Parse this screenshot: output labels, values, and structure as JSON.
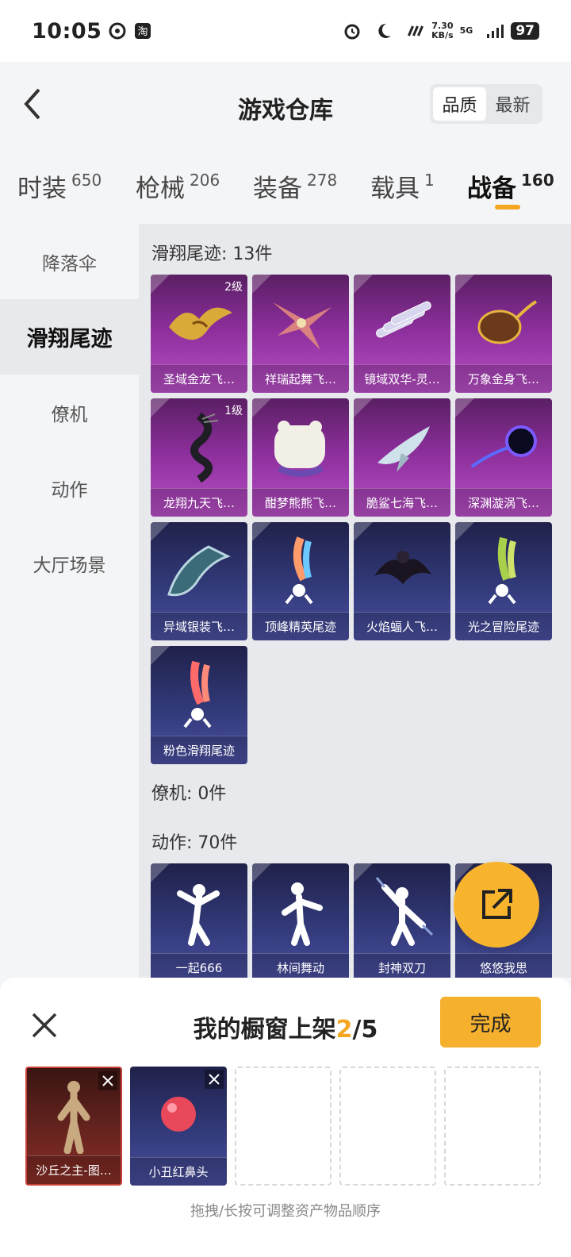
{
  "status_bar": {
    "time": "10:05",
    "net_speed_value": "7.30",
    "net_speed_unit": "KB/s",
    "network": "5G",
    "battery": "97"
  },
  "header": {
    "title": "游戏仓库",
    "sort_options": [
      "品质",
      "最新"
    ],
    "active_sort": "品质"
  },
  "category_tabs": [
    {
      "label": "时装",
      "count": "650"
    },
    {
      "label": "枪械",
      "count": "206"
    },
    {
      "label": "装备",
      "count": "278"
    },
    {
      "label": "载具",
      "count": "1"
    },
    {
      "label": "战备",
      "count": "160"
    }
  ],
  "active_tab": "战备",
  "sidebar": {
    "items": [
      "降落伞",
      "滑翔尾迹",
      "僚机",
      "动作",
      "大厅场景"
    ],
    "active": "滑翔尾迹"
  },
  "sections": {
    "glide_trails": {
      "title": "滑翔尾迹: 13件",
      "items": [
        {
          "name": "圣域金龙飞…",
          "level": "2级",
          "color": "#8b2e9a"
        },
        {
          "name": "祥瑞起舞飞…",
          "level": "",
          "color": "#8b2e9a"
        },
        {
          "name": "镜域双华-灵…",
          "level": "",
          "color": "#8b2e9a"
        },
        {
          "name": "万象金身飞…",
          "level": "",
          "color": "#8b2e9a"
        },
        {
          "name": "龙翔九天飞…",
          "level": "1级",
          "color": "#8b2e9a"
        },
        {
          "name": "酣梦熊熊飞…",
          "level": "",
          "color": "#8b2e9a"
        },
        {
          "name": "脆鲨七海飞…",
          "level": "",
          "color": "#8b2e9a"
        },
        {
          "name": "深渊漩涡飞…",
          "level": "",
          "color": "#8b2e9a"
        },
        {
          "name": "异域银装飞…",
          "level": "",
          "color": "#323a7a"
        },
        {
          "name": "顶峰精英尾迹",
          "level": "",
          "color": "#323a7a"
        },
        {
          "name": "火焰蝠人飞…",
          "level": "",
          "color": "#323a7a"
        },
        {
          "name": "光之冒险尾迹",
          "level": "",
          "color": "#323a7a"
        },
        {
          "name": "粉色滑翔尾迹",
          "level": "",
          "color": "#323a7a"
        }
      ]
    },
    "wingman": {
      "title": "僚机: 0件"
    },
    "emotes": {
      "title": "动作: 70件",
      "items": [
        {
          "name": "一起666"
        },
        {
          "name": "林间舞动"
        },
        {
          "name": "封神双刀"
        },
        {
          "name": "悠悠我思"
        }
      ]
    }
  },
  "showcase": {
    "title_prefix": "我的橱窗上架",
    "count_current": "2",
    "count_sep_total": "/5",
    "done_label": "完成",
    "slots": [
      {
        "name": "沙丘之主-图…",
        "rarity_color": "#8c2e27"
      },
      {
        "name": "小丑红鼻头",
        "rarity_color": "#323a7a"
      }
    ],
    "hint": "拖拽/长按可调整资产物品顺序"
  }
}
